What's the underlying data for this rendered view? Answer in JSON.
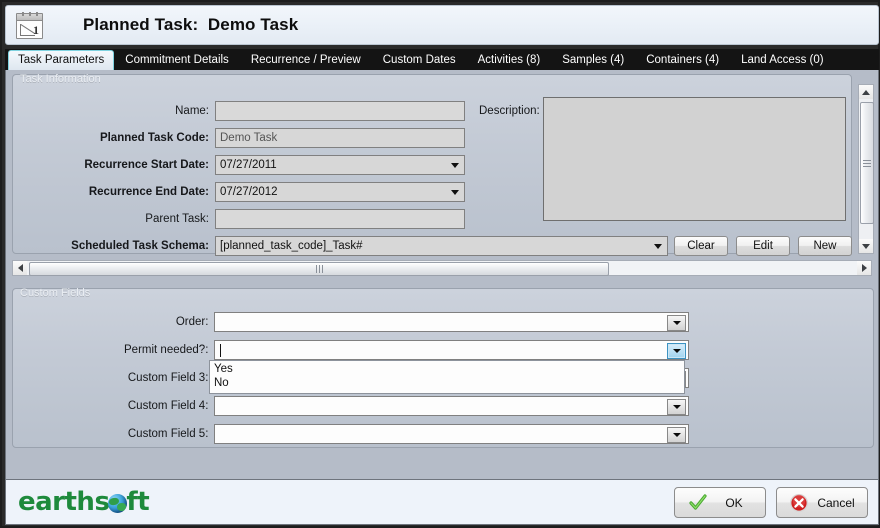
{
  "window": {
    "title_prefix": "Planned Task:",
    "title_value": "Demo Task",
    "icon": "calendar-task-icon",
    "calendar_day": "1"
  },
  "tabs": [
    {
      "label": "Task Parameters",
      "active": true
    },
    {
      "label": "Commitment Details",
      "active": false
    },
    {
      "label": "Recurrence / Preview",
      "active": false
    },
    {
      "label": "Custom Dates",
      "active": false
    },
    {
      "label": "Activities (8)",
      "active": false
    },
    {
      "label": "Samples (4)",
      "active": false
    },
    {
      "label": "Containers (4)",
      "active": false
    },
    {
      "label": "Land Access (0)",
      "active": false
    }
  ],
  "task_information": {
    "group_title": "Task Information",
    "fields": {
      "name": {
        "label": "Name:",
        "value": ""
      },
      "planned_task_code": {
        "label": "Planned Task Code:",
        "value": "Demo Task"
      },
      "recurrence_start_date": {
        "label": "Recurrence Start Date:",
        "value": "07/27/2011"
      },
      "recurrence_end_date": {
        "label": "Recurrence End Date:",
        "value": "07/27/2012"
      },
      "parent_task": {
        "label": "Parent Task:",
        "value": ""
      },
      "scheduled_task_schema": {
        "label": "Scheduled Task Schema:",
        "value": "[planned_task_code]_Task#"
      }
    },
    "description": {
      "label": "Description:",
      "value": ""
    },
    "buttons": {
      "clear": "Clear",
      "edit": "Edit",
      "new": "New"
    }
  },
  "custom_fields": {
    "group_title": "Custom Fields",
    "rows": [
      {
        "label": "Order:",
        "value": "",
        "focused": false
      },
      {
        "label": "Permit needed?:",
        "value": "",
        "focused": true
      },
      {
        "label": "Custom Field 3:",
        "value": "",
        "focused": false
      },
      {
        "label": "Custom Field 4:",
        "value": "",
        "focused": false
      },
      {
        "label": "Custom Field 5:",
        "value": "",
        "focused": false
      }
    ],
    "open_dropdown": {
      "owner": "Permit needed?:",
      "options": [
        "Yes",
        "No"
      ]
    }
  },
  "footer": {
    "logo_text_left": "earths",
    "logo_text_right": "ft",
    "logo_globe": "globe-icon",
    "ok_label": "OK",
    "cancel_label": "Cancel"
  },
  "colors": {
    "accent_tab": "#7fd3e0",
    "panel": "#c3cad5",
    "titlebar": "#eaf0f7",
    "ok_green": "#46a832",
    "cancel_red": "#cc2222",
    "logo_green": "#1e8a3c"
  }
}
